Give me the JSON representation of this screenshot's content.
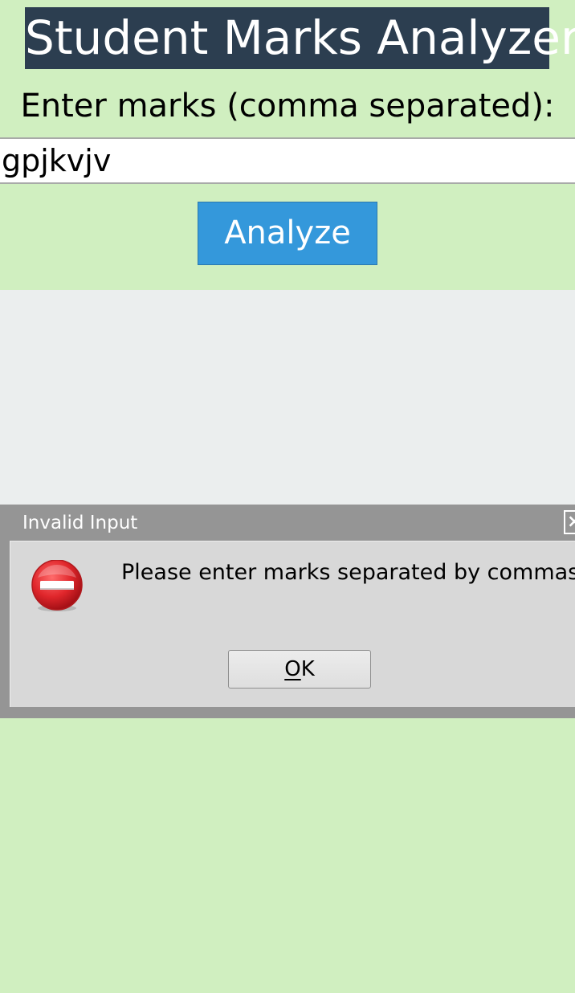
{
  "app": {
    "title": "Student Marks Analyzer",
    "prompt_label": "Enter marks (comma separated):",
    "marks_input": {
      "value": "gpjkvjv"
    },
    "analyze_button": {
      "label": "Analyze"
    }
  },
  "dialog": {
    "title": "Invalid Input",
    "message": "Please enter marks separated by commas",
    "icon": "error-icon",
    "ok_button": {
      "mnemonic": "O",
      "rest": "K"
    }
  },
  "colors": {
    "background": "#d0efc0",
    "title_bg": "#2c3e50",
    "button_bg": "#3498db",
    "result_area_bg": "#ebeeee",
    "dialog_frame": "#959595",
    "dialog_body": "#d8d8d8",
    "error_red": "#e0262b"
  }
}
